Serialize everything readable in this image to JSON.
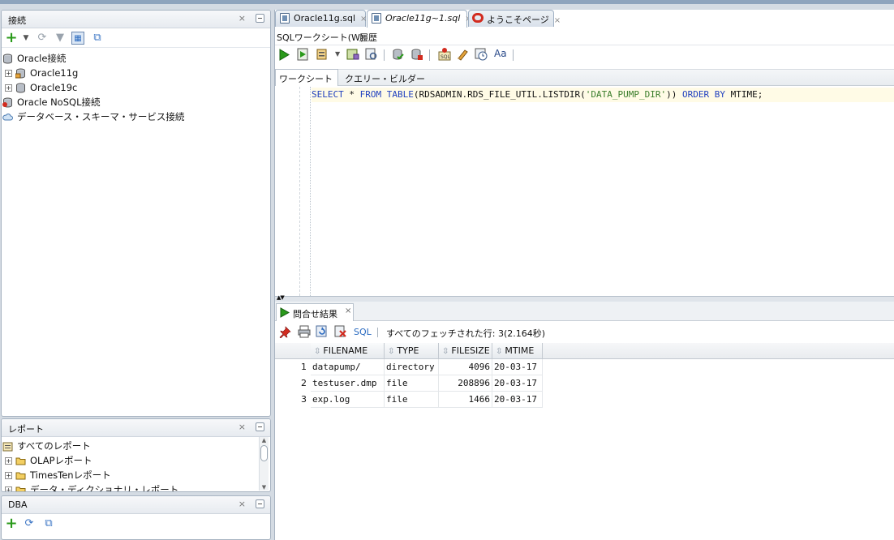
{
  "connections": {
    "title": "接続",
    "close": "×",
    "tree": [
      {
        "label": "Oracle接続"
      },
      {
        "label": "Oracle11g",
        "expander": "+"
      },
      {
        "label": "Oracle19c",
        "expander": "+"
      },
      {
        "label": "Oracle NoSQL接続"
      },
      {
        "label": "データベース・スキーマ・サービス接続"
      }
    ]
  },
  "reports": {
    "title": "レポート",
    "close": "×",
    "tree": [
      {
        "label": "すべてのレポート"
      },
      {
        "label": "OLAPレポート",
        "expander": "+"
      },
      {
        "label": "TimesTenレポート",
        "expander": "+"
      },
      {
        "label": "データ・ディクショナリ・レポート",
        "expander": "+"
      }
    ]
  },
  "dba": {
    "title": "DBA",
    "close": "×"
  },
  "tabs": [
    {
      "label": "Oracle11g.sql",
      "close": "×"
    },
    {
      "label": "Oracle11g~1.sql",
      "close": "×"
    },
    {
      "label": "ようこそページ",
      "close": "×"
    }
  ],
  "worksheet_menu": {
    "worksheet": "SQLワークシート(W)",
    "history": "履歴"
  },
  "subtabs": {
    "worksheet": "ワークシート",
    "query_builder": "クエリー・ビルダー"
  },
  "sql": {
    "select": "SELECT",
    "star": "*",
    "from": "FROM",
    "table": "TABLE",
    "call_open": "(RDSADMIN.RDS_FILE_UTIL.LISTDIR(",
    "string": "'DATA_PUMP_DIR'",
    "call_close": "))",
    "order": "ORDER",
    "by": "BY",
    "tail": "MTIME;"
  },
  "results": {
    "tab_label": "問合せ結果",
    "close": "×",
    "sql_link": "SQL",
    "status": "すべてのフェッチされた行: 3(2.164秒)",
    "columns": [
      "FILENAME",
      "TYPE",
      "FILESIZE",
      "MTIME"
    ],
    "rows": [
      {
        "n": "1",
        "filename": "datapump/",
        "type": "directory",
        "filesize": "4096",
        "mtime": "20-03-17"
      },
      {
        "n": "2",
        "filename": "testuser.dmp",
        "type": "file",
        "filesize": "208896",
        "mtime": "20-03-17"
      },
      {
        "n": "3",
        "filename": "exp.log",
        "type": "file",
        "filesize": "1466",
        "mtime": "20-03-17"
      }
    ]
  },
  "colors": {
    "keyword": "#1f3fbf",
    "string": "#3a7d2a",
    "oracle_red": "#d22b1f",
    "run_green": "#2a9a1a"
  }
}
